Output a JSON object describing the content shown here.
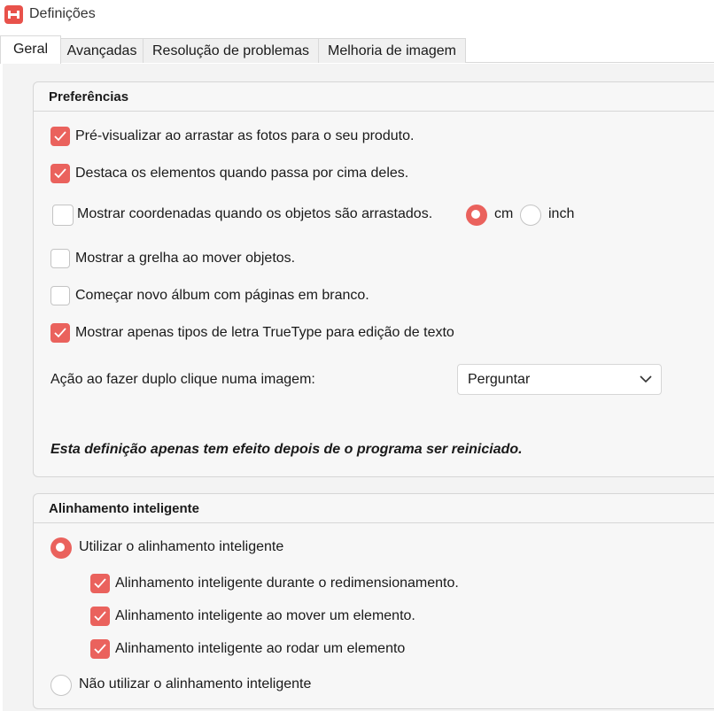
{
  "window": {
    "title": "Definições",
    "icon": "app-logo-icon"
  },
  "tabs": [
    {
      "label": "Geral",
      "active": true
    },
    {
      "label": "Avançadas",
      "active": false
    },
    {
      "label": "Resolução de problemas",
      "active": false
    },
    {
      "label": "Melhoria de imagem",
      "active": false
    }
  ],
  "preferences": {
    "title": "Preferências",
    "preview_drag": {
      "label": "Pré-visualizar ao arrastar as fotos para o seu produto.",
      "checked": true
    },
    "highlight_hover": {
      "label": "Destaca os elementos quando passa por cima deles.",
      "checked": true
    },
    "show_coords": {
      "label": "Mostrar coordenadas quando os objetos são arrastados.",
      "checked": false
    },
    "unit_cm": {
      "label": "cm",
      "selected": true
    },
    "unit_inch": {
      "label": "inch",
      "selected": false
    },
    "show_grid": {
      "label": "Mostrar a grelha ao mover objetos.",
      "checked": false
    },
    "blank_pages": {
      "label": "Começar novo álbum com páginas em branco.",
      "checked": false
    },
    "truetype_only": {
      "label": "Mostrar apenas tipos de letra TrueType para edição de texto",
      "checked": true
    },
    "double_click": {
      "label": "Ação ao fazer duplo clique numa imagem:",
      "value": "Perguntar"
    },
    "restart_note": "Esta definição apenas tem efeito depois de o programa ser reiniciado."
  },
  "smart_alignment": {
    "title": "Alinhamento inteligente",
    "use": {
      "label": "Utilizar o alinhamento inteligente",
      "selected": true
    },
    "on_resize": {
      "label": "Alinhamento inteligente durante o redimensionamento.",
      "checked": true
    },
    "on_move": {
      "label": "Alinhamento inteligente ao mover um elemento.",
      "checked": true
    },
    "on_rotate": {
      "label": "Alinhamento inteligente ao rodar um elemento",
      "checked": true
    },
    "dont_use": {
      "label": "Não utilizar o alinhamento inteligente",
      "selected": false
    }
  },
  "colors": {
    "accent": "#ea625d",
    "panel": "#f7f7f7",
    "border": "#d6d6d6"
  }
}
